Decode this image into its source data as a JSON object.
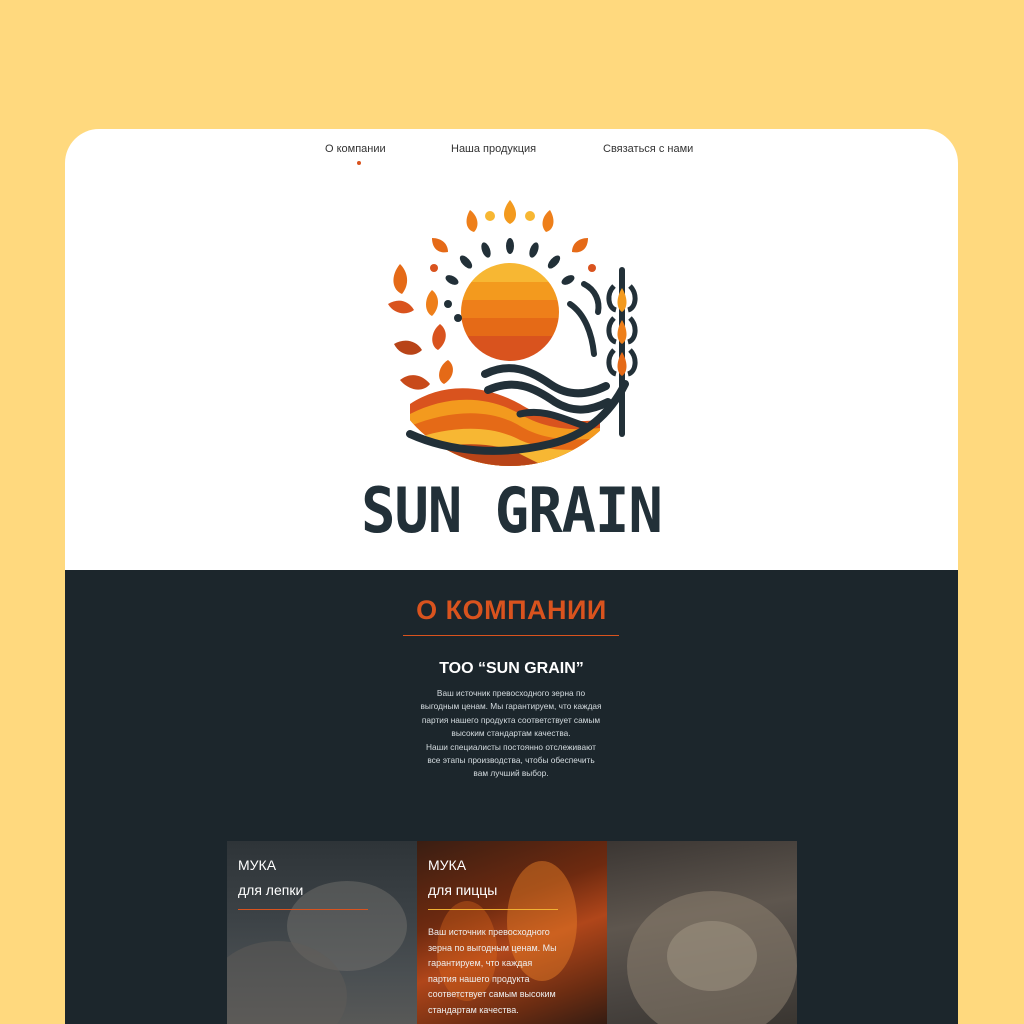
{
  "nav": {
    "items": [
      {
        "label": "О компании",
        "active": true
      },
      {
        "label": "Наша продукция",
        "active": false
      },
      {
        "label": "Связаться с нами",
        "active": false
      }
    ]
  },
  "brand": {
    "name": "SUN GRAIN"
  },
  "about": {
    "title": "О КОМПАНИИ",
    "company": "ТОО “SUN GRAIN”",
    "lines": [
      "Ваш источник превосходного зерна по",
      "выгодным ценам. Мы гарантируем, что каждая",
      "партия нашего продукта соответствует самым",
      "высоким стандартам качества.",
      "Наши специалисты постоянно отслеживают",
      "все этапы производства, чтобы обеспечить",
      "вам лучший выбор."
    ]
  },
  "products": [
    {
      "title": "МУКА",
      "subtitle": "для лепки",
      "line_color": "#D9531E"
    },
    {
      "title": "МУКА",
      "subtitle": "для пиццы",
      "line_color": "#F2B233",
      "text_lines": [
        "Ваш источник превосходного",
        "зерна по выгодным ценам. Мы",
        "гарантируем, что каждая",
        "партия нашего продукта",
        "соответствует самым высоким",
        "стандартам качества."
      ]
    }
  ],
  "colors": {
    "page_background": "#FFD97E",
    "accent": "#D9531E",
    "dark_section": "#1C262C",
    "brand_text": "#223038"
  }
}
